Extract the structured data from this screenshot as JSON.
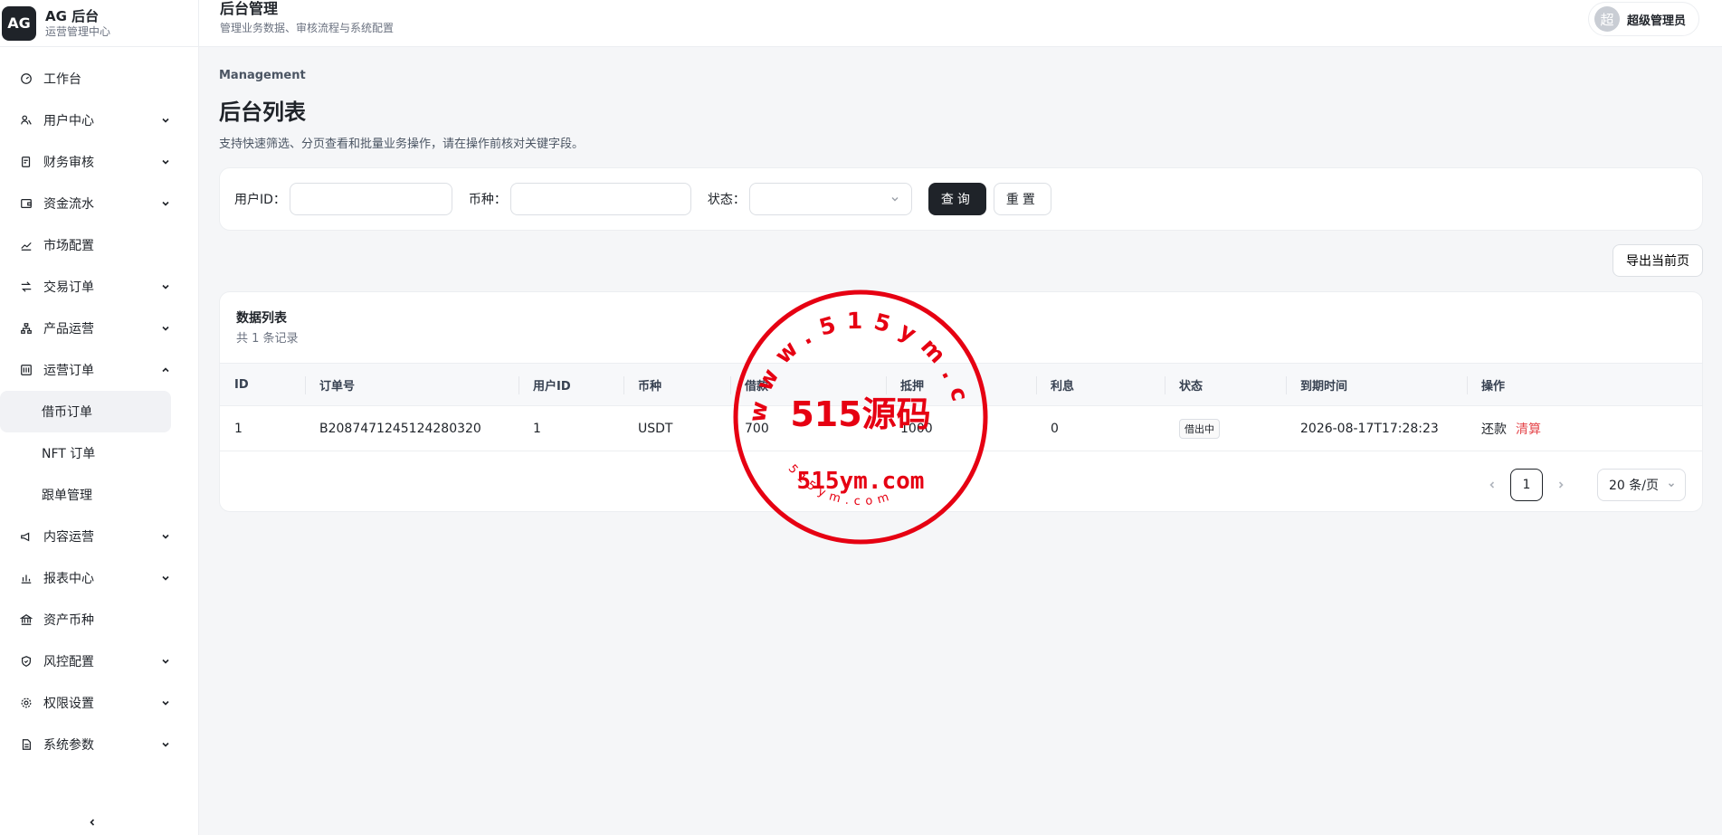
{
  "brand": {
    "logo": "AG",
    "title": "AG 后台",
    "subtitle": "运营管理中心"
  },
  "header": {
    "title": "后台管理",
    "subtitle": "管理业务数据、审核流程与系统配置"
  },
  "user": {
    "avatar_text": "超",
    "name": "超级管理员"
  },
  "sidebar": {
    "items": [
      {
        "label": "工作台",
        "icon": "dashboard-icon",
        "has_children": false
      },
      {
        "label": "用户中心",
        "icon": "users-icon",
        "has_children": true
      },
      {
        "label": "财务审核",
        "icon": "audit-icon",
        "has_children": true
      },
      {
        "label": "资金流水",
        "icon": "wallet-icon",
        "has_children": true
      },
      {
        "label": "市场配置",
        "icon": "chart-line-icon",
        "has_children": false
      },
      {
        "label": "交易订单",
        "icon": "swap-icon",
        "has_children": true
      },
      {
        "label": "产品运营",
        "icon": "hierarchy-icon",
        "has_children": true
      },
      {
        "label": "运营订单",
        "icon": "orders-icon",
        "has_children": true,
        "expanded": true,
        "children": [
          {
            "label": "借币订单",
            "active": true
          },
          {
            "label": "NFT 订单"
          },
          {
            "label": "跟单管理"
          }
        ]
      },
      {
        "label": "内容运营",
        "icon": "megaphone-icon",
        "has_children": true
      },
      {
        "label": "报表中心",
        "icon": "bar-chart-icon",
        "has_children": true
      },
      {
        "label": "资产币种",
        "icon": "bank-icon",
        "has_children": false
      },
      {
        "label": "风控配置",
        "icon": "shield-icon",
        "has_children": true
      },
      {
        "label": "权限设置",
        "icon": "gear-icon",
        "has_children": true
      },
      {
        "label": "系统参数",
        "icon": "document-icon",
        "has_children": true
      }
    ]
  },
  "page": {
    "eyebrow": "Management",
    "title": "后台列表",
    "description": "支持快速筛选、分页查看和批量业务操作，请在操作前核对关键字段。"
  },
  "filters": {
    "user_id_label": "用户ID：",
    "user_id_value": "",
    "currency_label": "币种：",
    "currency_value": "",
    "status_label": "状态：",
    "status_value": "",
    "search_label": "查询",
    "reset_label": "重置"
  },
  "toolbar": {
    "export_label": "导出当前页"
  },
  "table": {
    "title": "数据列表",
    "count_text": "共 1 条记录",
    "columns": [
      "ID",
      "订单号",
      "用户ID",
      "币种",
      "借款",
      "抵押",
      "利息",
      "状态",
      "到期时间",
      "操作"
    ],
    "rows": [
      {
        "id": "1",
        "order_no": "B2087471245124280320",
        "user_id": "1",
        "currency": "USDT",
        "loan": "700",
        "collateral": "1000",
        "interest": "0",
        "status": "借出中",
        "due_time": "2026-08-17T17:28:23",
        "actions": [
          "还款",
          "清算"
        ]
      }
    ]
  },
  "pagination": {
    "current_page": "1",
    "page_size": "20 条/页"
  },
  "watermark": {
    "top_text": "www.515ym.com",
    "center_text": "515源码",
    "site_text": "515ym.com",
    "bottom_text": "515ym.com",
    "color": "#e60012"
  },
  "colors": {
    "primary": "#1f2329",
    "danger": "#e5484d"
  }
}
